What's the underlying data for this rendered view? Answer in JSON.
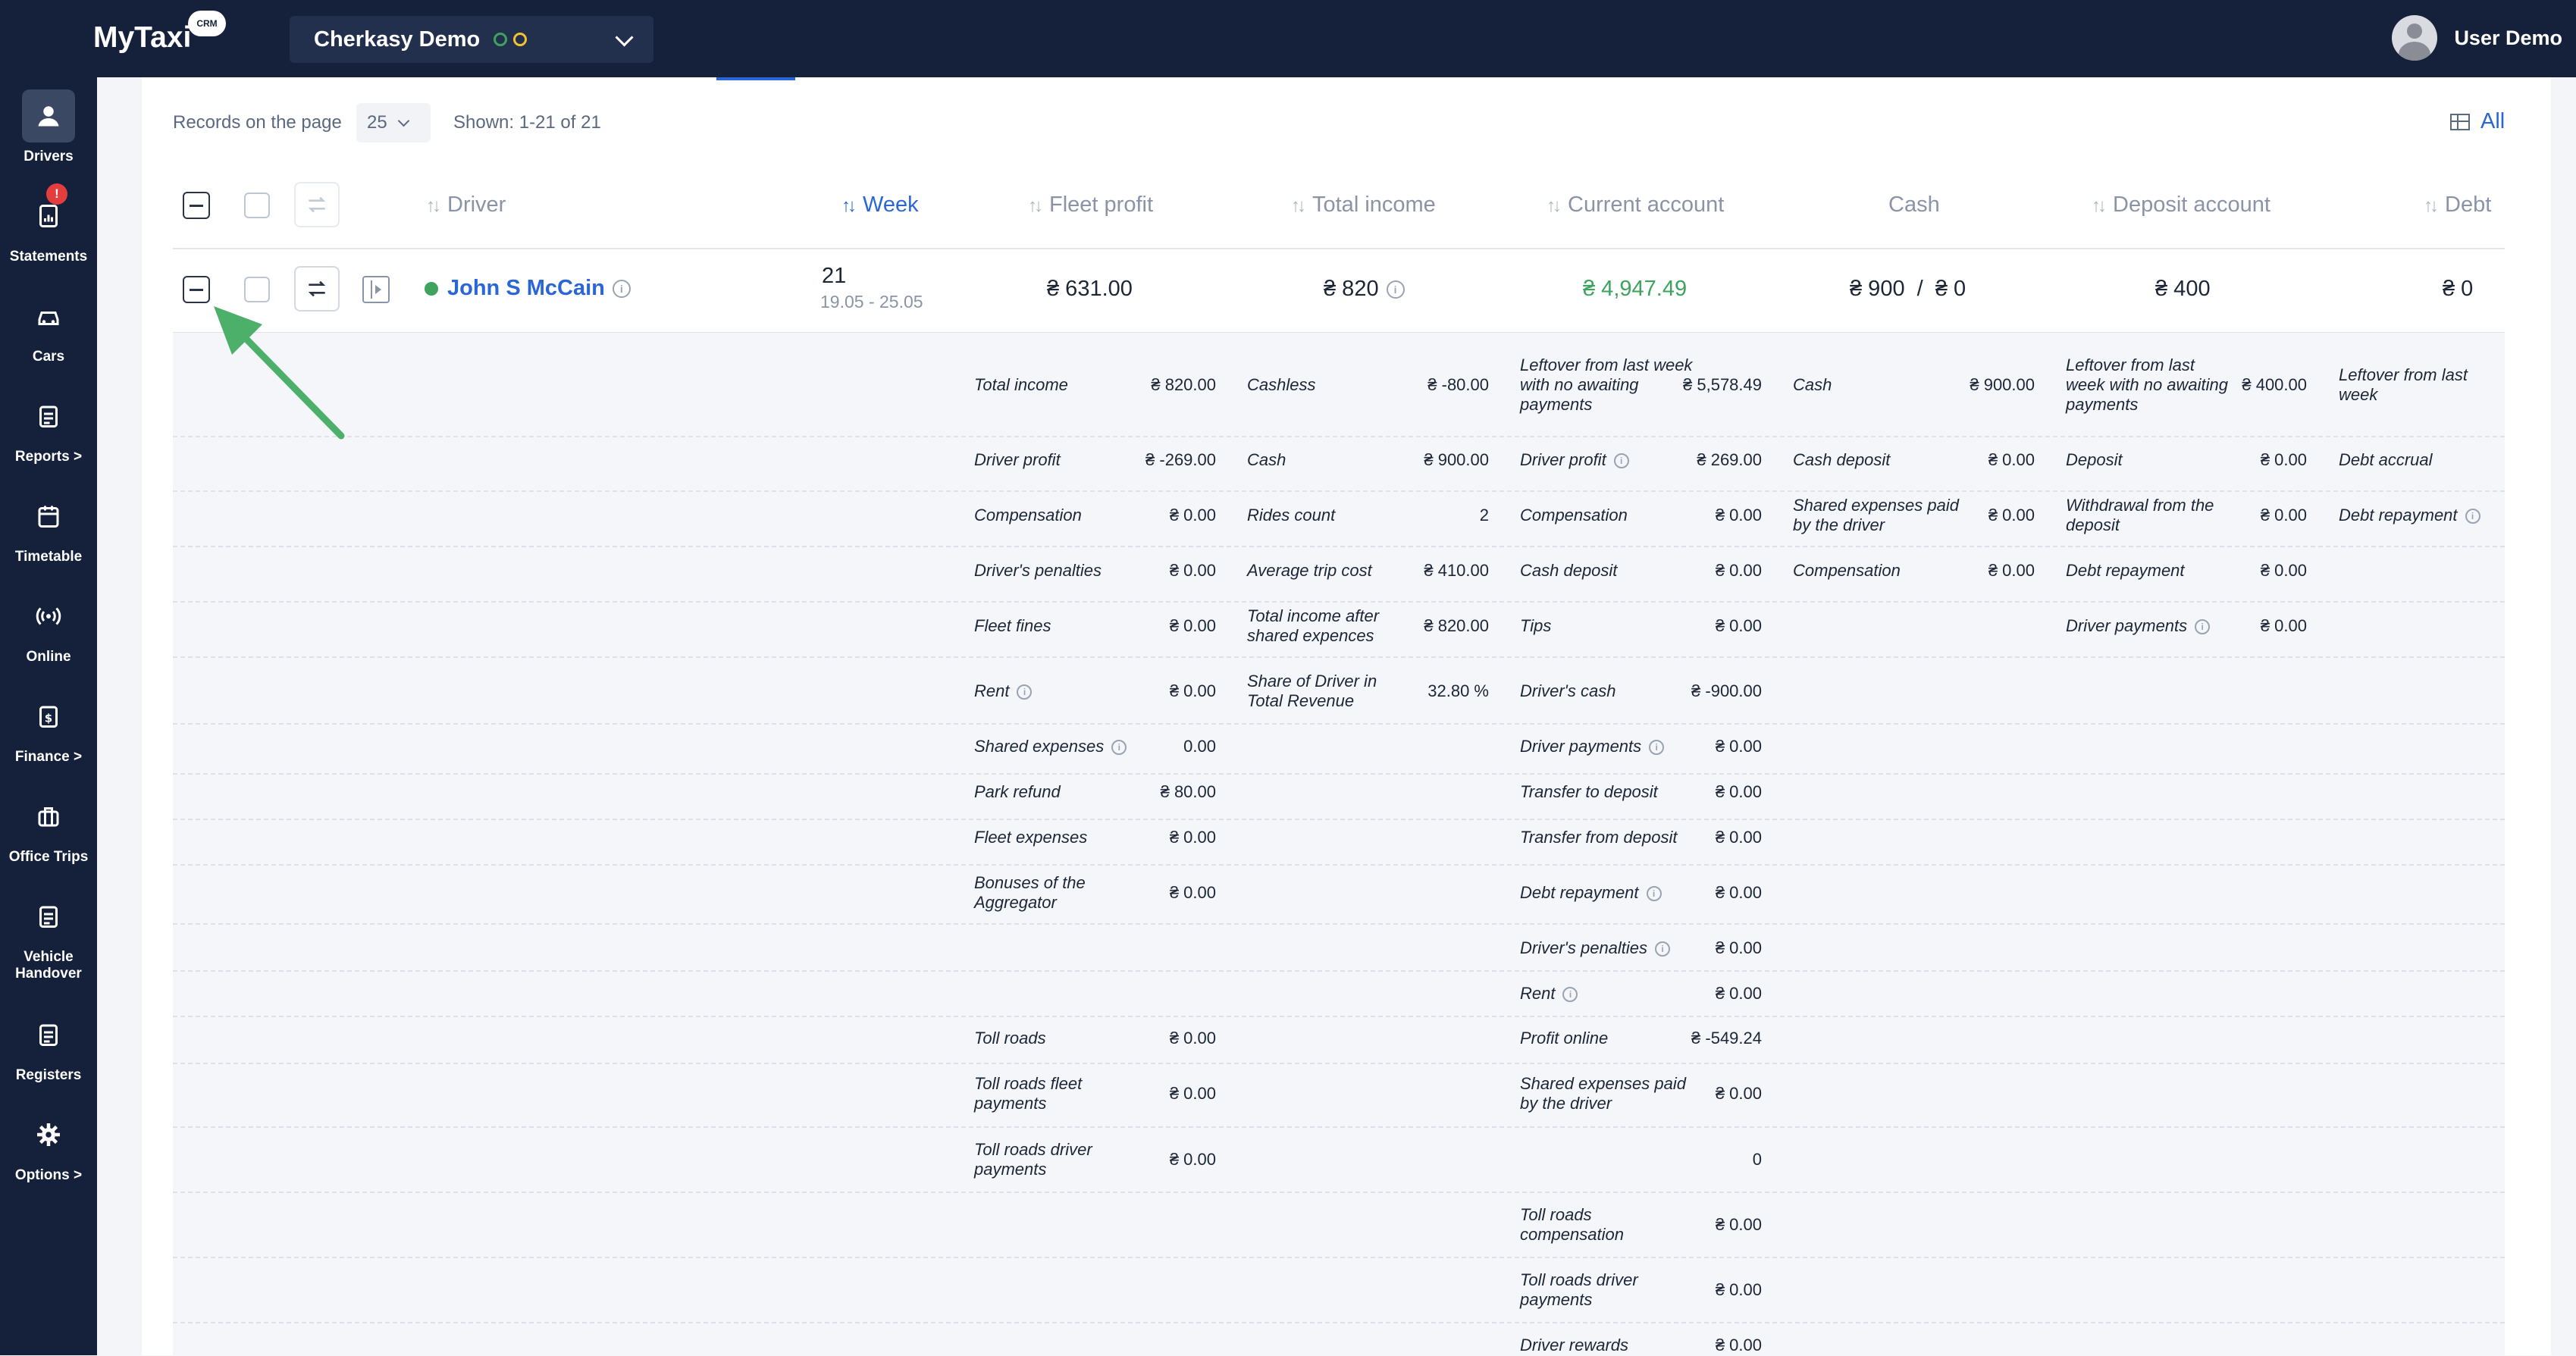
{
  "app": {
    "logo": "MyTaxi",
    "logo_badge": "CRM",
    "company": "Cherkasy Demo",
    "user": "User Demo"
  },
  "sidebar": [
    {
      "label": "Drivers",
      "icon": "user-icon"
    },
    {
      "label": "Statements",
      "icon": "statement-icon",
      "badge": "!"
    },
    {
      "label": "Cars",
      "icon": "car-icon"
    },
    {
      "label": "Reports >",
      "icon": "clipboard-icon"
    },
    {
      "label": "Timetable",
      "icon": "calendar-icon"
    },
    {
      "label": "Online",
      "icon": "broadcast-icon"
    },
    {
      "label": "Finance >",
      "icon": "finance-icon"
    },
    {
      "label": "Office Trips",
      "icon": "briefcase-icon"
    },
    {
      "label": "Vehicle Handover",
      "icon": "clipboard-icon"
    },
    {
      "label": "Registers",
      "icon": "clipboard-icon"
    },
    {
      "label": "Options >",
      "icon": "gear-icon"
    }
  ],
  "toolbar": {
    "records_label": "Records on the page",
    "records_value": "25",
    "shown": "Shown: 1-21 of 21",
    "all": "All"
  },
  "columns": [
    "Driver",
    "Week",
    "Fleet profit",
    "Total income",
    "Current account",
    "Cash",
    "Deposit account",
    "Debt"
  ],
  "row": {
    "driver": "John S McCain",
    "week": "21",
    "week_range": "19.05 - 25.05",
    "fleet_profit": "₴ 631.00",
    "total_income": "₴ 820",
    "current_account": "₴ 4,947.49",
    "cash": "₴ 900  /  ₴ 0",
    "deposit": "₴ 400",
    "debt": "₴ 0"
  },
  "details": {
    "col1": [
      {
        "l": "Total income",
        "v": "₴ 820.00"
      },
      {
        "l": "Driver profit",
        "v": "₴ -269.00"
      },
      {
        "l": "Compensation",
        "v": "₴ 0.00"
      },
      {
        "l": "Driver's penalties",
        "v": "₴ 0.00"
      },
      {
        "l": "Fleet fines",
        "v": "₴ 0.00"
      },
      {
        "l": "Rent",
        "v": "₴ 0.00"
      },
      {
        "l": "Shared expenses",
        "v": "0.00"
      },
      {
        "l": "Park refund",
        "v": "₴ 80.00"
      },
      {
        "l": "Fleet expenses",
        "v": "₴ 0.00"
      },
      {
        "l": "Bonuses of the Aggregator",
        "v": "₴ 0.00"
      },
      {
        "l": "Toll roads",
        "v": "₴ 0.00"
      },
      {
        "l": "Toll roads fleet payments",
        "v": "₴ 0.00"
      },
      {
        "l": "Toll roads driver payments",
        "v": "₴ 0.00"
      }
    ],
    "col2": [
      {
        "l": "Cashless",
        "v": "₴ -80.00"
      },
      {
        "l": "Cash",
        "v": "₴ 900.00"
      },
      {
        "l": "Rides count",
        "v": "2"
      },
      {
        "l": "Average trip cost",
        "v": "₴ 410.00"
      },
      {
        "l": "Total income after shared expences",
        "v": "₴ 820.00"
      },
      {
        "l": "Share of Driver in Total Revenue",
        "v": "32.80 %"
      }
    ],
    "col3": [
      {
        "l": "Leftover from last week with no awaiting payments",
        "v": "₴ 5,578.49"
      },
      {
        "l": "Driver profit",
        "v": "₴ 269.00"
      },
      {
        "l": "Compensation",
        "v": "₴ 0.00"
      },
      {
        "l": "Cash deposit",
        "v": "₴ 0.00"
      },
      {
        "l": "Tips",
        "v": "₴ 0.00"
      },
      {
        "l": "Driver's cash",
        "v": "₴ -900.00"
      },
      {
        "l": "Driver payments",
        "v": "₴ 0.00"
      },
      {
        "l": "Transfer to deposit",
        "v": "₴ 0.00"
      },
      {
        "l": "Transfer from deposit",
        "v": "₴ 0.00"
      },
      {
        "l": "Debt repayment",
        "v": "₴ 0.00"
      },
      {
        "l": "Driver's penalties",
        "v": "₴ 0.00"
      },
      {
        "l": "Rent",
        "v": "₴ 0.00"
      },
      {
        "l": "Profit online",
        "v": "₴ -549.24"
      },
      {
        "l": "Shared expenses paid by the driver",
        "v": "₴ 0.00"
      },
      {
        "l": "",
        "v": "0"
      },
      {
        "l": "Toll roads compensation",
        "v": "₴ 0.00"
      },
      {
        "l": "Toll roads driver payments",
        "v": "₴ 0.00"
      },
      {
        "l": "Driver rewards",
        "v": "₴ 0.00"
      }
    ],
    "col4": [
      {
        "l": "Cash",
        "v": "₴ 900.00"
      },
      {
        "l": "Cash deposit",
        "v": "₴ 0.00"
      },
      {
        "l": "Shared expenses paid by the driver",
        "v": "₴ 0.00"
      },
      {
        "l": "Compensation",
        "v": "₴ 0.00"
      }
    ],
    "col5": [
      {
        "l": "Leftover from last week with no awaiting payments",
        "v": "₴ 400.00"
      },
      {
        "l": "Deposit",
        "v": "₴ 0.00"
      },
      {
        "l": "Withdrawal from the deposit",
        "v": "₴ 0.00"
      },
      {
        "l": "Debt repayment",
        "v": "₴ 0.00"
      },
      {
        "l": "Driver payments",
        "v": "₴ 0.00"
      }
    ],
    "col6": [
      {
        "l": "Leftover from last week"
      },
      {
        "l": "Debt accrual"
      },
      {
        "l": "Debt repayment"
      }
    ]
  },
  "colors": {
    "nav_bg": "#15203a",
    "accent": "#2a66d6",
    "green": "#3da35d",
    "arrow": "#4caf6a"
  }
}
